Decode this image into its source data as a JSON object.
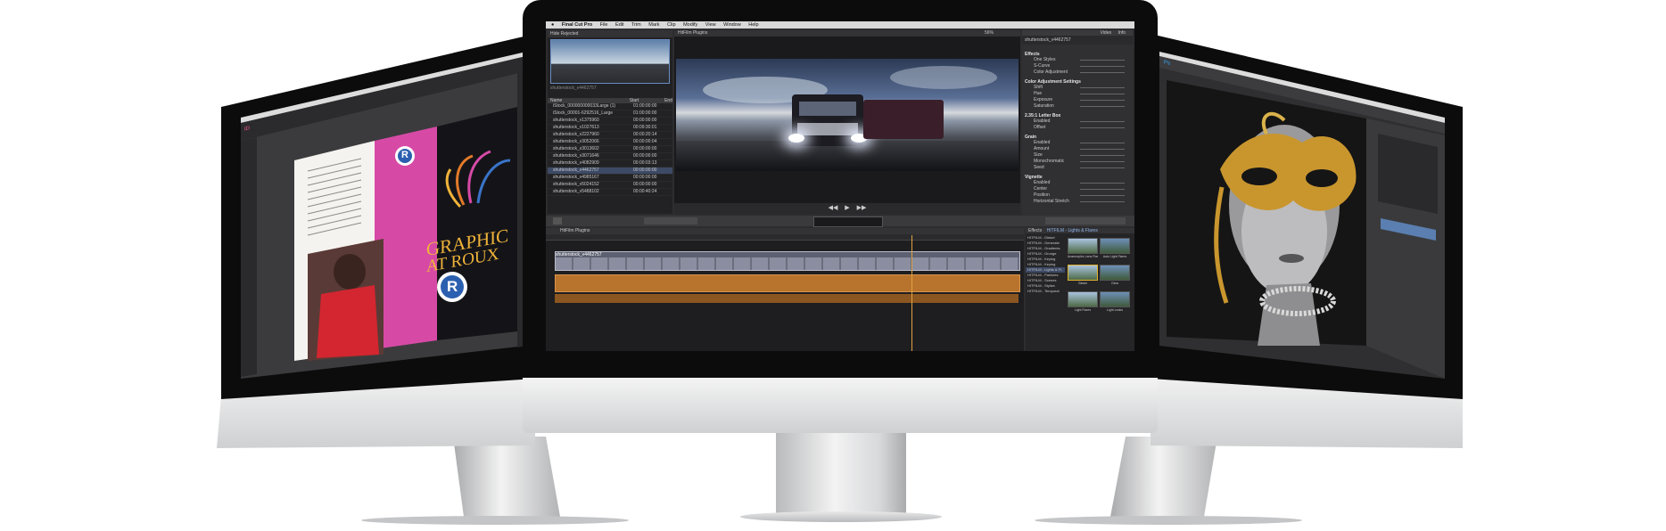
{
  "fcp": {
    "menu": [
      "Final Cut Pro",
      "File",
      "Edit",
      "Trim",
      "Mark",
      "Clip",
      "Modify",
      "View",
      "Window",
      "Help"
    ],
    "viewer_title": "HitFilm Plugins",
    "zoom": "56%",
    "inspector_tabs": [
      "Video",
      "Info"
    ],
    "clip_name": "shutterstock_v4462757",
    "browser_filter": "Hide Rejected",
    "browser_headers": [
      "Name",
      "Start",
      "End"
    ],
    "browser_rows": [
      [
        "iStock_000000000033Large (1)",
        "01:00:00:00"
      ],
      [
        "iStock_00001-6292516_Large",
        "01:00:00:00"
      ],
      [
        "shutterstock_v1375960",
        "00:00:00:00"
      ],
      [
        "shutterstock_v1027613",
        "00:09:30:01"
      ],
      [
        "shutterstock_v2227960",
        "00:00:20:14"
      ],
      [
        "shutterstock_v3052066",
        "00:00:00:04"
      ],
      [
        "shutterstock_v3013602",
        "00:00:00:00"
      ],
      [
        "shutterstock_v3071646",
        "00:00:00:00"
      ],
      [
        "shutterstock_v4082909",
        "00:00:03:13"
      ],
      [
        "shutterstock_v4462757",
        "00:00:00:00"
      ],
      [
        "shutterstock_v4985167",
        "00:00:00:00"
      ],
      [
        "shutterstock_v5024152",
        "00:00:00:00"
      ],
      [
        "shutterstock_v5488102",
        "00:00:40:24"
      ]
    ],
    "inspector": {
      "sections": [
        "Effects",
        "Color Adjustment Settings",
        "2.35:1 Letter Box",
        "Grain",
        "Vignette"
      ],
      "fields": [
        "One Styles",
        "S-Curve",
        "Color Adjustment",
        "Shift",
        "Hue",
        "Exposure",
        "Saturation",
        "Enabled",
        "Offset",
        "Enabled",
        "Amount",
        "Size",
        "Monochromatic",
        "Seed",
        "Enabled",
        "Center",
        "Position",
        "Horizontal Stretch"
      ]
    },
    "timeline_title": "HitFilm Plugins",
    "timeline_clip": "shutterstock_v4462757",
    "effects_title": "Effects",
    "effects_category": "HITFILM - Lights & Flares",
    "effects_list": [
      "HITFILM - Distort",
      "HITFILM - Generate",
      "HITFILM - Gradients",
      "HITFILM - Grunge",
      "HITFILM - Keying",
      "HITFILM - Keying",
      "HITFILM - Lights & Fl.",
      "HITFILM - Particles",
      "HITFILM - Scenes",
      "HITFILM - Stylize",
      "HITFILM - Temporal"
    ],
    "effect_thumbs": [
      "Anamorphic Lens Flare",
      "Auto Light Flares",
      "Gleam",
      "Glow",
      "Light Flares",
      "Light Leaks"
    ]
  },
  "indesign": {
    "app_badge": "ID",
    "heading": [
      "GRAPHIC",
      "AT ROUX"
    ],
    "logo_letter": "R"
  },
  "photoshop": {
    "app_badge": "Ps"
  },
  "colors": {
    "bezel": "#0c0c0d",
    "fcp_ui": "#2d2d30",
    "timeline_clip": "#8a8ea0",
    "audio_track": "#b8732c",
    "magenta_page": "#d64aa6",
    "mask_gold": "#c9962e"
  }
}
